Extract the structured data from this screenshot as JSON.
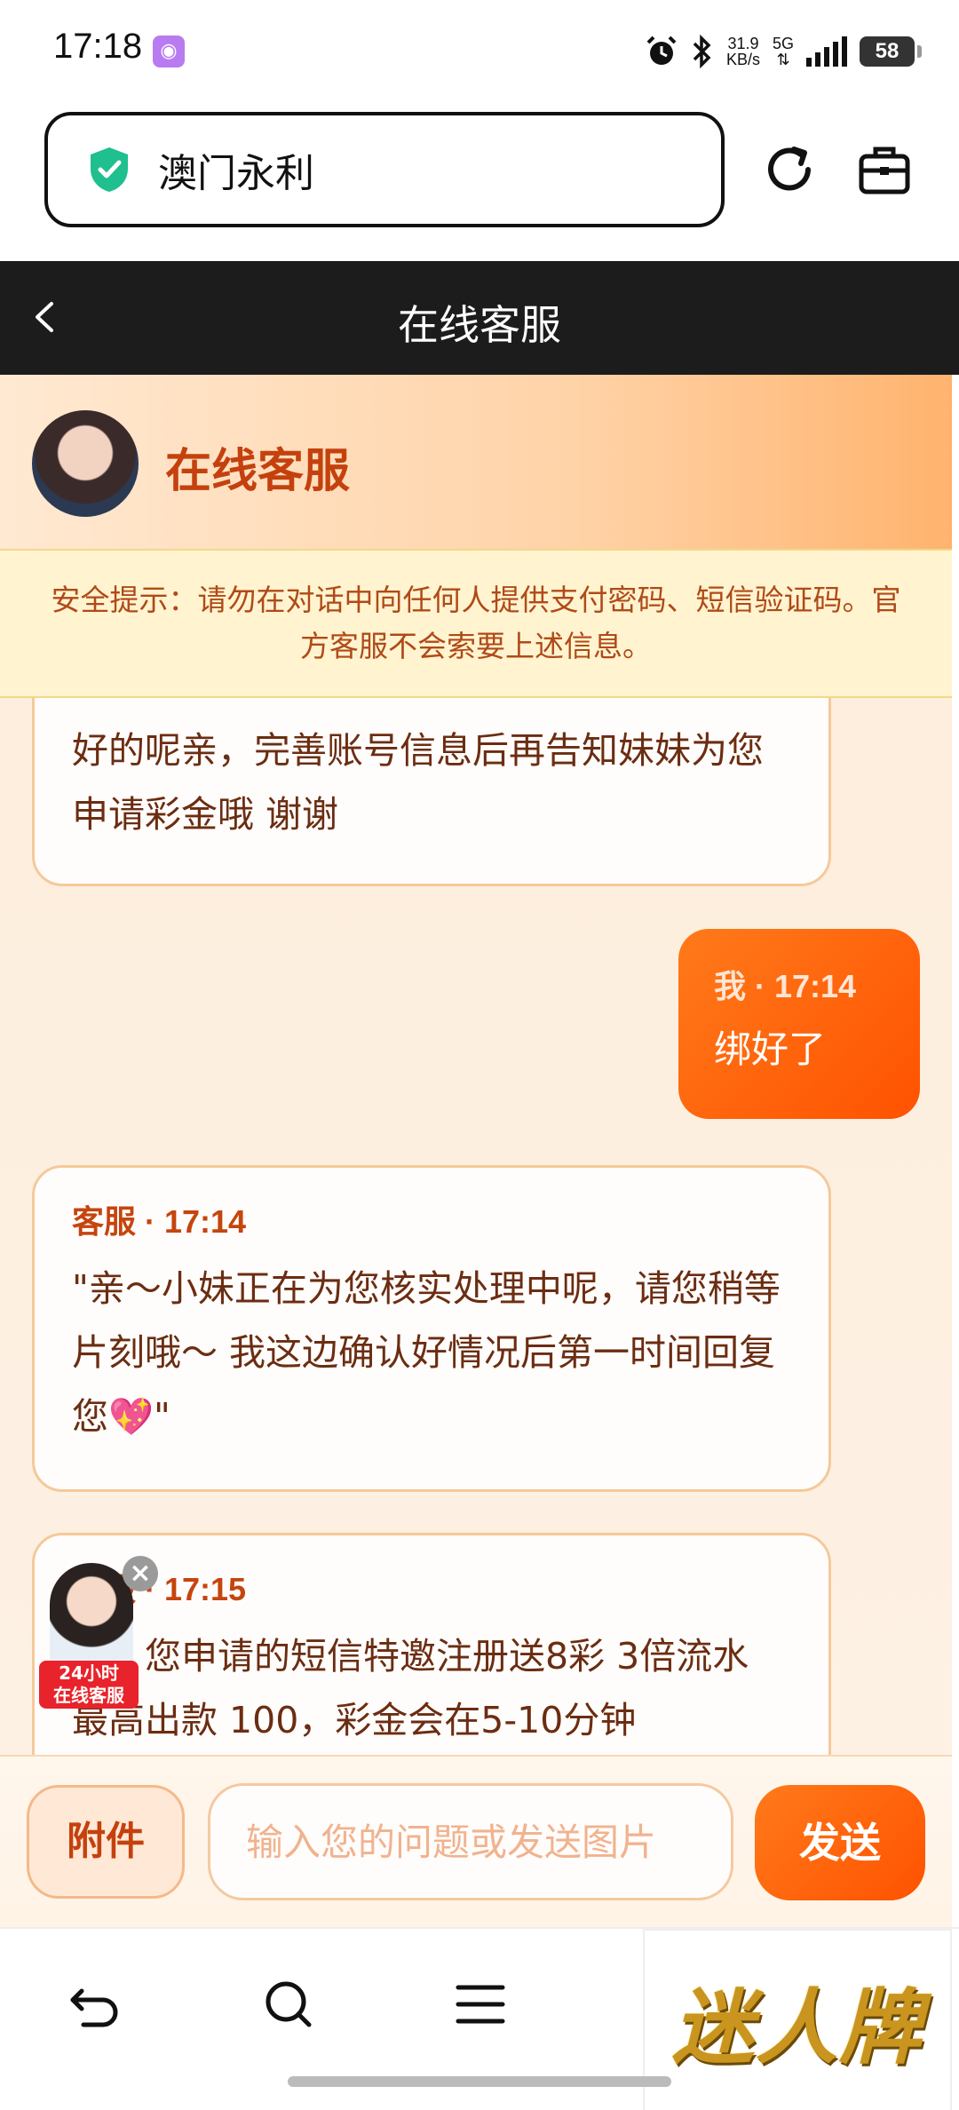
{
  "status_bar": {
    "time": "17:18",
    "app_icon": "purple-app-icon",
    "net_speed": "31.9",
    "net_unit": "KB/s",
    "network": "5G",
    "battery": "58"
  },
  "browser": {
    "url_text": "澳门永利",
    "secure_icon": "shield-check-icon",
    "accent": "#1fbf8f"
  },
  "page_header": {
    "title": "在线客服"
  },
  "chat_header": {
    "title": "在线客服"
  },
  "notice": {
    "text": "安全提示：请勿在对话中向任何人提供支付密码、短信验证码。官方客服不会索要上述信息。"
  },
  "messages": [
    {
      "sender": "",
      "time": "",
      "text": "好的呢亲，完善账号信息后再告知妹妹为您申请彩金哦 谢谢"
    },
    {
      "sender": "我",
      "time": "17:14",
      "meta": "我 · 17:14",
      "text": "绑好了"
    },
    {
      "sender": "客服",
      "time": "17:14",
      "meta": "客服 · 17:14",
      "text": "\"亲～小妹正在为您核实处理中呢，请您稍等片刻哦～ 我这边确认好情况后第一时间回复您💖\""
    },
    {
      "sender": "客服",
      "time": "17:15",
      "meta": "客服 · 17:15",
      "text": "亲，您申请的短信特邀注册送8彩 3倍流水 最高出款 100，彩金会在5-10分钟"
    }
  ],
  "floating_badge": {
    "line1": "24小时",
    "line2": "在线客服",
    "close": "×"
  },
  "input_bar": {
    "attach_label": "附件",
    "placeholder": "输入您的问题或发送图片",
    "send_label": "发送"
  },
  "promo": {
    "text": "迷人牌"
  },
  "colors": {
    "brand_orange": "#ff6a0f",
    "header_dark": "#1c1c1c",
    "text_brown": "#6b2d12"
  }
}
